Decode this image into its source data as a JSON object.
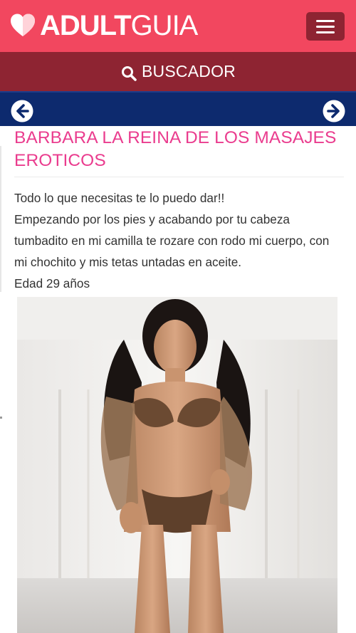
{
  "header": {
    "logo": {
      "bold": "ADULT",
      "light": "GUIA",
      "brand_color": "#f2475f"
    },
    "menu_icon": "hamburger-menu-icon"
  },
  "search": {
    "label": "BUSCADOR",
    "icon": "search-icon",
    "color": "#8e2432"
  },
  "nav": {
    "prev_icon": "arrow-left-icon",
    "next_icon": "arrow-right-icon",
    "color": "#0d2a6e"
  },
  "listing": {
    "title": "BARBARA LA REINA DE LOS MASAJES EROTICOS",
    "title_color": "#ea3c8e",
    "lines": [
      "Todo lo que necesitas te lo puedo dar!!",
      "Empezando por los pies y acabando por tu cabeza tumbadito en mi camilla te rozare con rodo mi cuerpo, con mi chochito y mis tetas untadas en aceite.",
      "Edad 29 años"
    ]
  }
}
